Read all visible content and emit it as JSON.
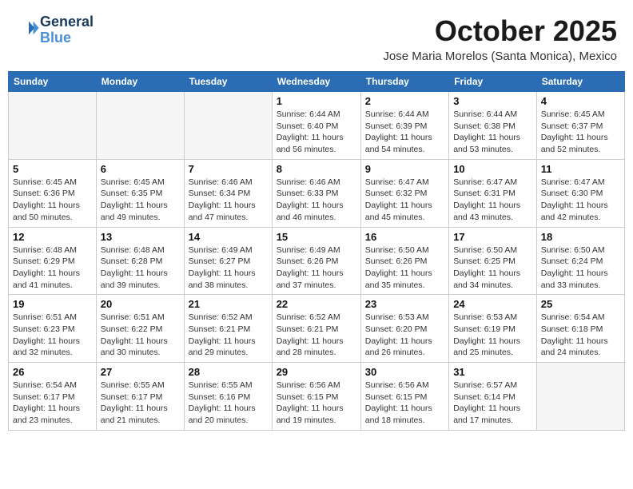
{
  "header": {
    "logo_line1": "General",
    "logo_line2": "Blue",
    "month_title": "October 2025",
    "location": "Jose Maria Morelos (Santa Monica), Mexico"
  },
  "weekdays": [
    "Sunday",
    "Monday",
    "Tuesday",
    "Wednesday",
    "Thursday",
    "Friday",
    "Saturday"
  ],
  "weeks": [
    [
      {
        "day": "",
        "info": ""
      },
      {
        "day": "",
        "info": ""
      },
      {
        "day": "",
        "info": ""
      },
      {
        "day": "1",
        "info": "Sunrise: 6:44 AM\nSunset: 6:40 PM\nDaylight: 11 hours\nand 56 minutes."
      },
      {
        "day": "2",
        "info": "Sunrise: 6:44 AM\nSunset: 6:39 PM\nDaylight: 11 hours\nand 54 minutes."
      },
      {
        "day": "3",
        "info": "Sunrise: 6:44 AM\nSunset: 6:38 PM\nDaylight: 11 hours\nand 53 minutes."
      },
      {
        "day": "4",
        "info": "Sunrise: 6:45 AM\nSunset: 6:37 PM\nDaylight: 11 hours\nand 52 minutes."
      }
    ],
    [
      {
        "day": "5",
        "info": "Sunrise: 6:45 AM\nSunset: 6:36 PM\nDaylight: 11 hours\nand 50 minutes."
      },
      {
        "day": "6",
        "info": "Sunrise: 6:45 AM\nSunset: 6:35 PM\nDaylight: 11 hours\nand 49 minutes."
      },
      {
        "day": "7",
        "info": "Sunrise: 6:46 AM\nSunset: 6:34 PM\nDaylight: 11 hours\nand 47 minutes."
      },
      {
        "day": "8",
        "info": "Sunrise: 6:46 AM\nSunset: 6:33 PM\nDaylight: 11 hours\nand 46 minutes."
      },
      {
        "day": "9",
        "info": "Sunrise: 6:47 AM\nSunset: 6:32 PM\nDaylight: 11 hours\nand 45 minutes."
      },
      {
        "day": "10",
        "info": "Sunrise: 6:47 AM\nSunset: 6:31 PM\nDaylight: 11 hours\nand 43 minutes."
      },
      {
        "day": "11",
        "info": "Sunrise: 6:47 AM\nSunset: 6:30 PM\nDaylight: 11 hours\nand 42 minutes."
      }
    ],
    [
      {
        "day": "12",
        "info": "Sunrise: 6:48 AM\nSunset: 6:29 PM\nDaylight: 11 hours\nand 41 minutes."
      },
      {
        "day": "13",
        "info": "Sunrise: 6:48 AM\nSunset: 6:28 PM\nDaylight: 11 hours\nand 39 minutes."
      },
      {
        "day": "14",
        "info": "Sunrise: 6:49 AM\nSunset: 6:27 PM\nDaylight: 11 hours\nand 38 minutes."
      },
      {
        "day": "15",
        "info": "Sunrise: 6:49 AM\nSunset: 6:26 PM\nDaylight: 11 hours\nand 37 minutes."
      },
      {
        "day": "16",
        "info": "Sunrise: 6:50 AM\nSunset: 6:26 PM\nDaylight: 11 hours\nand 35 minutes."
      },
      {
        "day": "17",
        "info": "Sunrise: 6:50 AM\nSunset: 6:25 PM\nDaylight: 11 hours\nand 34 minutes."
      },
      {
        "day": "18",
        "info": "Sunrise: 6:50 AM\nSunset: 6:24 PM\nDaylight: 11 hours\nand 33 minutes."
      }
    ],
    [
      {
        "day": "19",
        "info": "Sunrise: 6:51 AM\nSunset: 6:23 PM\nDaylight: 11 hours\nand 32 minutes."
      },
      {
        "day": "20",
        "info": "Sunrise: 6:51 AM\nSunset: 6:22 PM\nDaylight: 11 hours\nand 30 minutes."
      },
      {
        "day": "21",
        "info": "Sunrise: 6:52 AM\nSunset: 6:21 PM\nDaylight: 11 hours\nand 29 minutes."
      },
      {
        "day": "22",
        "info": "Sunrise: 6:52 AM\nSunset: 6:21 PM\nDaylight: 11 hours\nand 28 minutes."
      },
      {
        "day": "23",
        "info": "Sunrise: 6:53 AM\nSunset: 6:20 PM\nDaylight: 11 hours\nand 26 minutes."
      },
      {
        "day": "24",
        "info": "Sunrise: 6:53 AM\nSunset: 6:19 PM\nDaylight: 11 hours\nand 25 minutes."
      },
      {
        "day": "25",
        "info": "Sunrise: 6:54 AM\nSunset: 6:18 PM\nDaylight: 11 hours\nand 24 minutes."
      }
    ],
    [
      {
        "day": "26",
        "info": "Sunrise: 6:54 AM\nSunset: 6:17 PM\nDaylight: 11 hours\nand 23 minutes."
      },
      {
        "day": "27",
        "info": "Sunrise: 6:55 AM\nSunset: 6:17 PM\nDaylight: 11 hours\nand 21 minutes."
      },
      {
        "day": "28",
        "info": "Sunrise: 6:55 AM\nSunset: 6:16 PM\nDaylight: 11 hours\nand 20 minutes."
      },
      {
        "day": "29",
        "info": "Sunrise: 6:56 AM\nSunset: 6:15 PM\nDaylight: 11 hours\nand 19 minutes."
      },
      {
        "day": "30",
        "info": "Sunrise: 6:56 AM\nSunset: 6:15 PM\nDaylight: 11 hours\nand 18 minutes."
      },
      {
        "day": "31",
        "info": "Sunrise: 6:57 AM\nSunset: 6:14 PM\nDaylight: 11 hours\nand 17 minutes."
      },
      {
        "day": "",
        "info": ""
      }
    ]
  ]
}
